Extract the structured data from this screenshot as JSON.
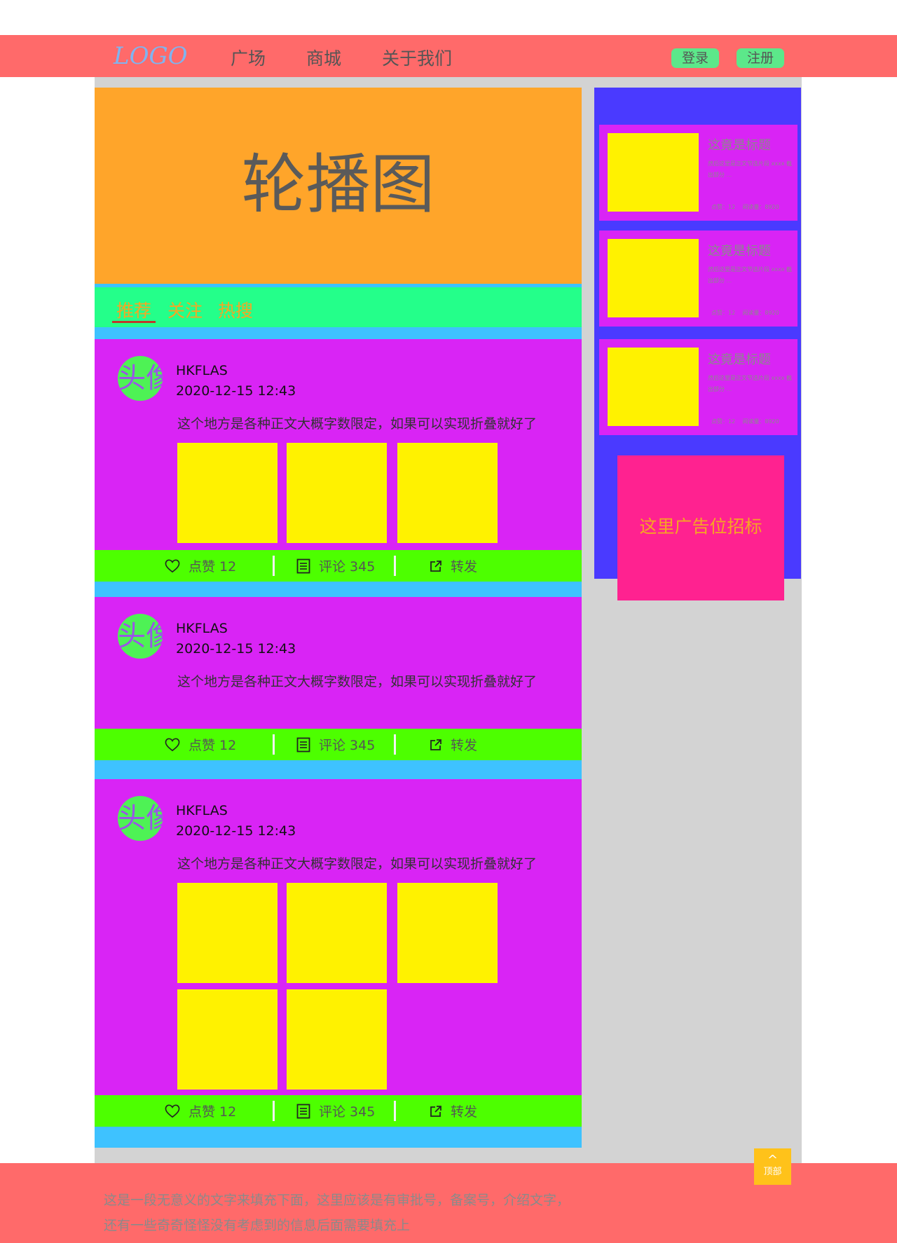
{
  "header": {
    "logo": "LOGO",
    "nav": [
      "广场",
      "商城",
      "关于我们"
    ],
    "login": "登录",
    "register": "注册"
  },
  "banner": {
    "text": "轮播图"
  },
  "tabs": [
    "推荐",
    "关注",
    "热搜"
  ],
  "posts": [
    {
      "avatar": "头像",
      "author": "HKFLAS",
      "time": "2020-12-15 12:43",
      "text": "这个地方是各种正文大概字数限定，如果可以实现折叠就好了",
      "image_count": 3,
      "likes": "点赞 12",
      "comments": "评论 345",
      "share": "转发"
    },
    {
      "avatar": "头像",
      "author": "HKFLAS",
      "time": "2020-12-15 12:43",
      "text": "这个地方是各种正文大概字数限定，如果可以实现折叠就好了",
      "image_count": 0,
      "likes": "点赞 12",
      "comments": "评论 345",
      "share": "转发"
    },
    {
      "avatar": "头像",
      "author": "HKFLAS",
      "time": "2020-12-15 12:43",
      "text": "这个地方是各种正文大概字数限定，如果可以实现折叠就好了",
      "image_count": 5,
      "likes": "点赞 12",
      "comments": "评论 345",
      "share": "转发"
    }
  ],
  "sidebar": {
    "cards": [
      {
        "title": "这竟是标题",
        "desc": "然后这里是正文节选片段 xxxx 截出部分 ...",
        "likes": "点赞：12",
        "reads": "阅读量：8920"
      },
      {
        "title": "这竟是标题",
        "desc": "然后这里是正文节选片段 xxxx 截出部分 ...",
        "likes": "点赞：12",
        "reads": "阅读量：8920"
      },
      {
        "title": "这竟是标题",
        "desc": "然后这里是正文节选片段 xxxx 截出部分 ...",
        "likes": "点赞：12",
        "reads": "阅读量：8920"
      }
    ],
    "ad": "这里广告位招标"
  },
  "footer": {
    "line1": "这是一段无意义的文字来填充下面，这里应该是有审批号，备案号，介绍文字，",
    "line2": "还有一些奇奇怪怪没有考虑到的信息后面需要填充上"
  },
  "back_to_top": {
    "arrow": "^",
    "label": "顶部"
  },
  "colors": {
    "header": "#ff6a6a",
    "banner": "#ffa52a",
    "tabbar": "#24ff8a",
    "post": "#d924f5",
    "actions": "#4dff00",
    "thumb": "#fff200",
    "sidebar": "#4a3aff",
    "ad": "#ff2290",
    "feed_bg": "#3ec2ff",
    "accent": "#f5a623"
  },
  "icons": {
    "like": "heart-icon",
    "comment": "list-icon",
    "share": "share-icon"
  }
}
